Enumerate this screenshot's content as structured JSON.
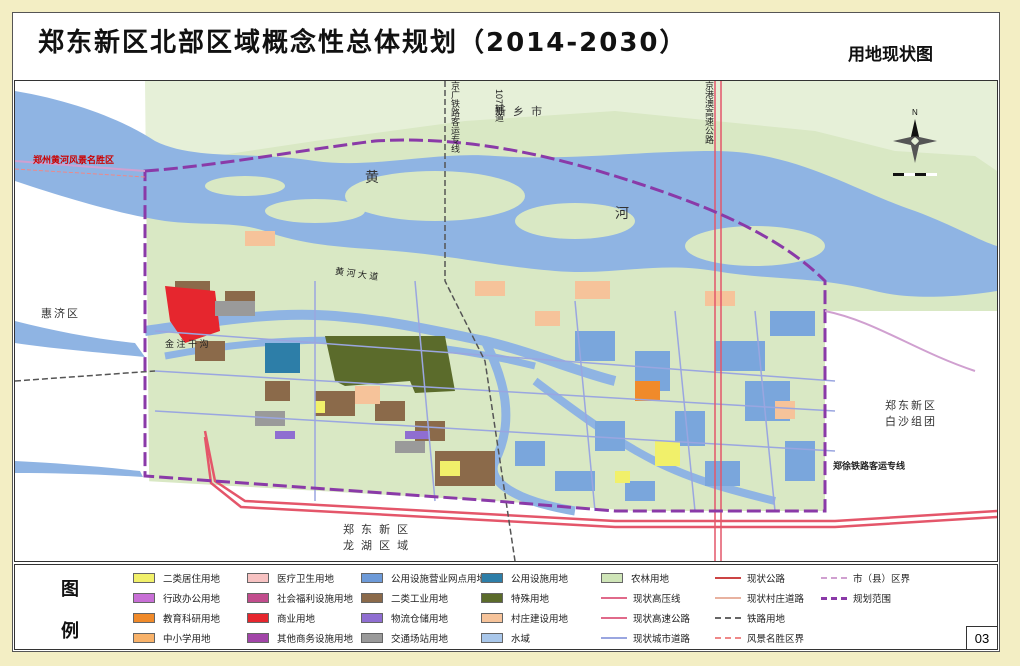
{
  "title": "郑东新区北部区域概念性总体规划（2014-2030）",
  "subtitle": "用地现状图",
  "page_number": "03",
  "map_labels": {
    "xinxiang": "新 乡 市",
    "huizhong": "惠济区",
    "baisha": "郑东新区\n白沙组团",
    "longhu": "郑 东 新 区\n龙 湖 区 域",
    "huang": "黄",
    "he": "河",
    "huanghe_dadao": "黄 河 大 道",
    "jinshui": "金 注 干 沟",
    "fengjing": "郑州黄河风景名胜区",
    "jinggu": "京广铁路客运专线",
    "jinggangao": "京港澳高速公路",
    "fudao": "107辅道",
    "zhengxu": "郑徐铁路客运专线"
  },
  "legend": {
    "title_a": "图",
    "title_b": "例",
    "items": [
      {
        "label": "二类居住用地",
        "color": "#f1f06a"
      },
      {
        "label": "行政办公用地",
        "color": "#c86fd6"
      },
      {
        "label": "教育科研用地",
        "color": "#f08a2a"
      },
      {
        "label": "中小学用地",
        "color": "#f8b26a"
      },
      {
        "label": "医疗卫生用地",
        "color": "#f7c2c2"
      },
      {
        "label": "社会福利设施用地",
        "color": "#c24d8d"
      },
      {
        "label": "商业用地",
        "color": "#e6262e"
      },
      {
        "label": "其他商务设施用地",
        "color": "#a245a8"
      },
      {
        "label": "公用设施营业网点用地",
        "color": "#6d9ad8"
      },
      {
        "label": "二类工业用地",
        "color": "#8b6a4a"
      },
      {
        "label": "物流仓储用地",
        "color": "#8f6ed1"
      },
      {
        "label": "交通场站用地",
        "color": "#9a9a9a"
      },
      {
        "label": "公用设施用地",
        "color": "#2d7ea8"
      },
      {
        "label": "特殊用地",
        "color": "#5b6b2b"
      },
      {
        "label": "村庄建设用地",
        "color": "#f6c39a"
      },
      {
        "label": "水域",
        "color": "#a9c7ea"
      },
      {
        "label": "农林用地",
        "color": "#cfe5b8"
      },
      {
        "label": "现状高压线",
        "color": "#e06a8a"
      },
      {
        "label": "现状高速公路",
        "color": "#e06a8a"
      },
      {
        "label": "现状城市道路",
        "color": "#9aa6e0"
      },
      {
        "label": "现状公路",
        "color": "#c44"
      },
      {
        "label": "现状村庄道路",
        "color": "#e8b2a0"
      },
      {
        "label": "铁路用地",
        "color": "#666"
      },
      {
        "label": "风景名胜区界",
        "color": "#e88"
      },
      {
        "label": "市（县）区界",
        "color": "#d0a0d0"
      },
      {
        "label": "规划范围",
        "color": "#8a3aa8"
      }
    ]
  },
  "colors": {
    "water": "#8fb4e3",
    "farmland": "#d9e8c4",
    "boundary": "#8a3aa8",
    "highway": "#e4566a",
    "background": "#f3eec4"
  }
}
